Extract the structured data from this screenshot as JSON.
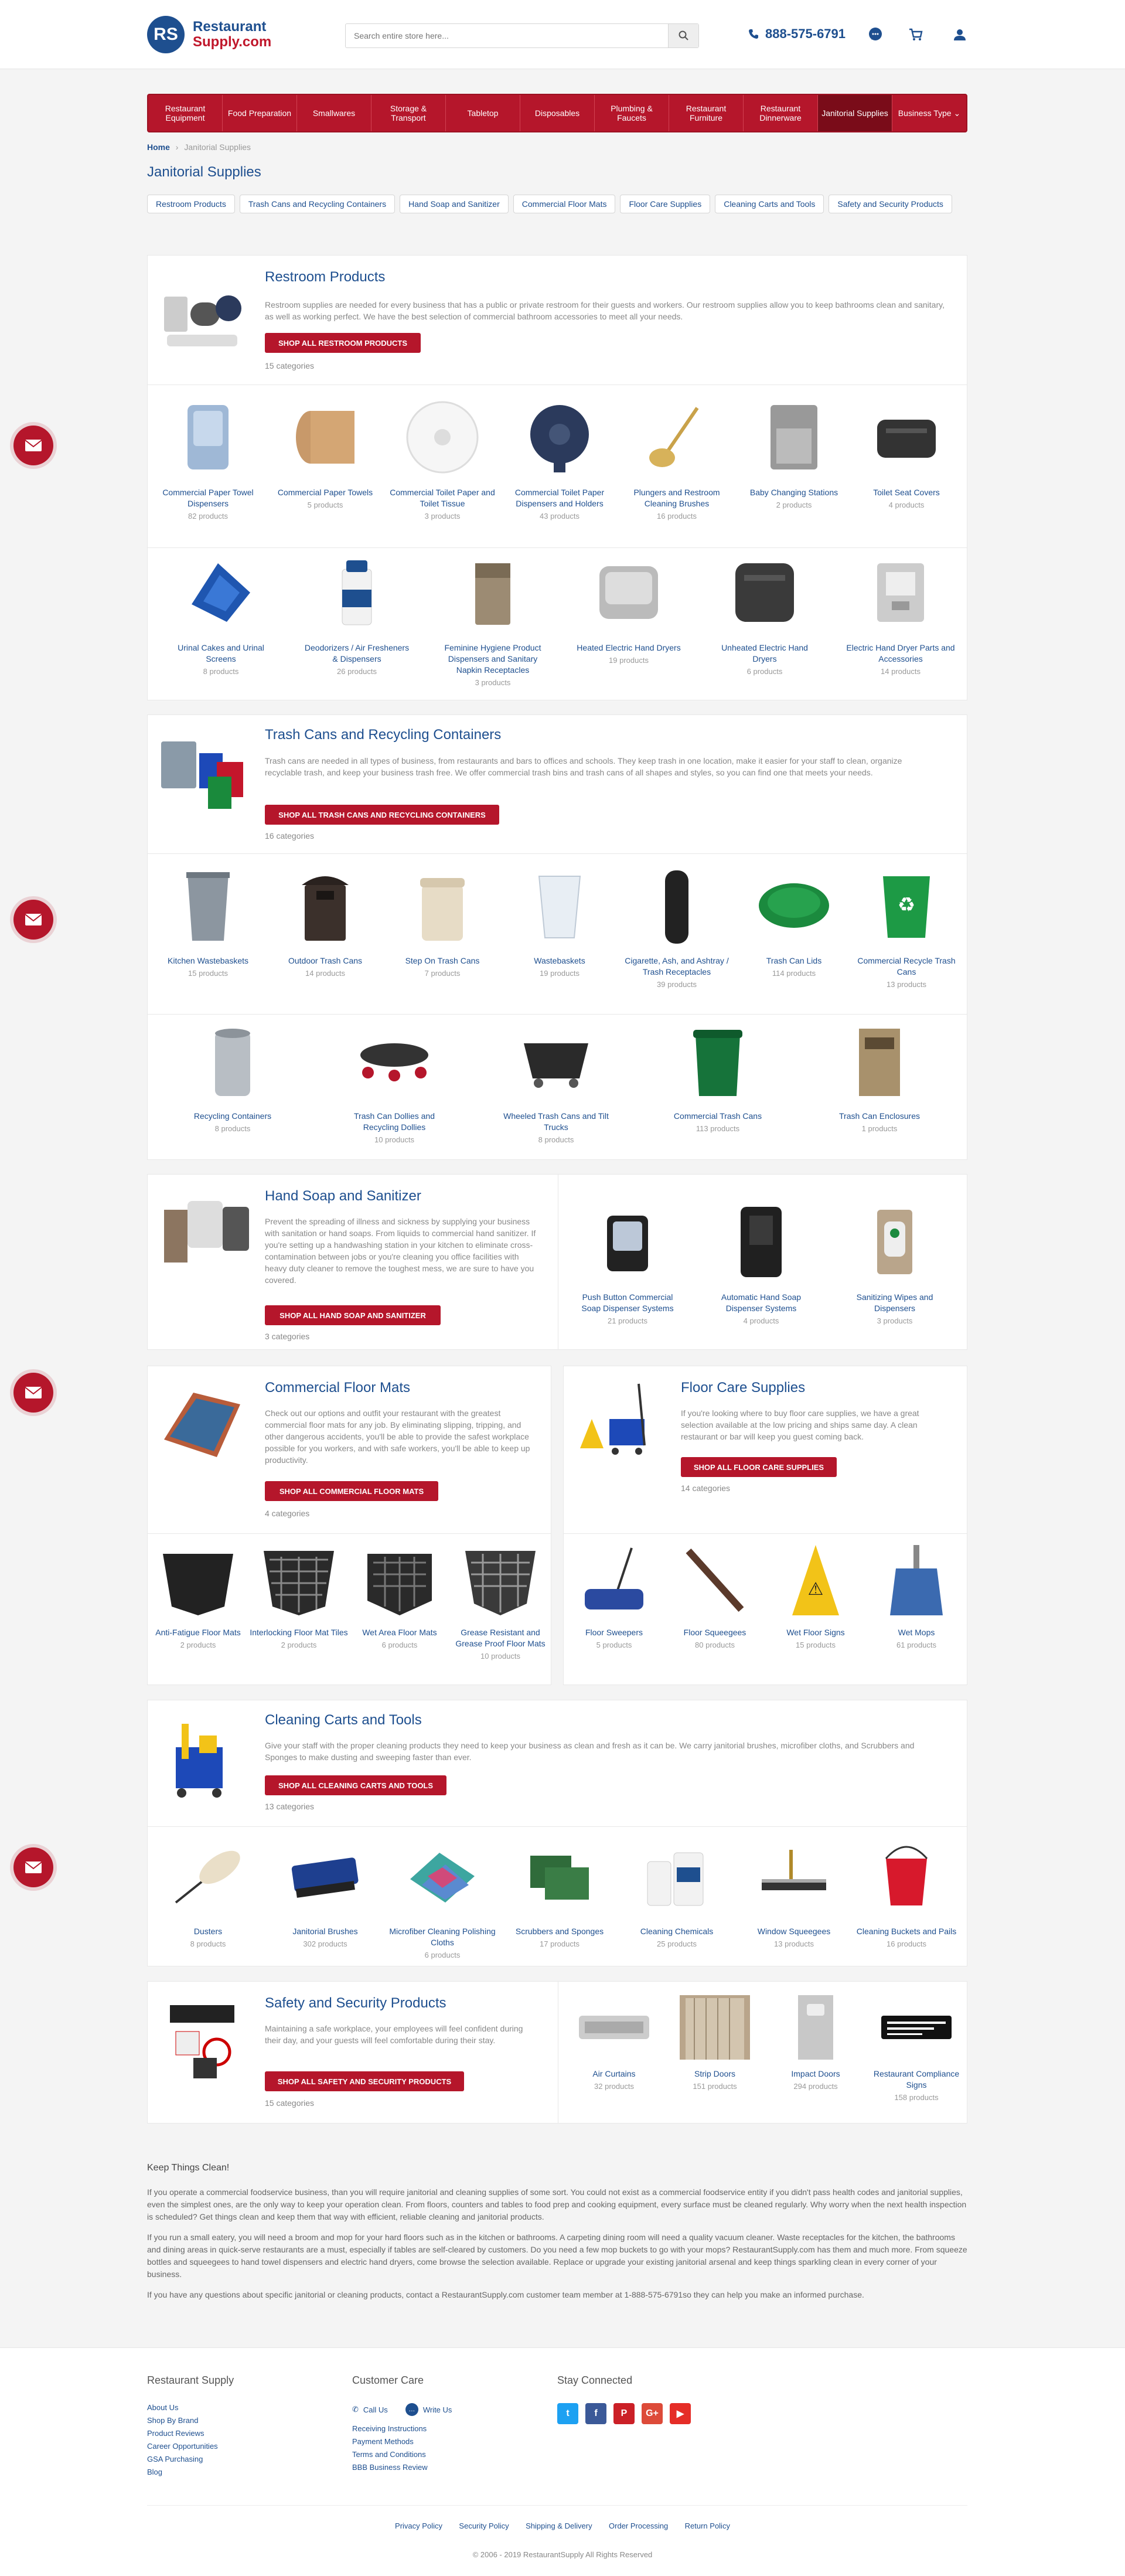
{
  "header": {
    "logo_mark": "RS",
    "logo_line1": "Restaurant",
    "logo_line2": "Supply.com",
    "search_placeholder": "Search entire store here...",
    "phone": "888-575-6791"
  },
  "nav": [
    "Restaurant Equipment",
    "Food Preparation",
    "Smallwares",
    "Storage & Transport",
    "Tabletop",
    "Disposables",
    "Plumbing & Faucets",
    "Restaurant Furniture",
    "Restaurant Dinnerware",
    "Janitorial Supplies",
    "Business Type"
  ],
  "breadcrumb": {
    "home": "Home",
    "sep": "›",
    "current": "Janitorial Supplies"
  },
  "page_title": "Janitorial Supplies",
  "chips": [
    "Restroom Products",
    "Trash Cans and Recycling Containers",
    "Hand Soap and Sanitizer",
    "Commercial Floor Mats",
    "Floor Care Supplies",
    "Cleaning Carts and Tools",
    "Safety and Security Products"
  ],
  "restroom": {
    "title": "Restroom Products",
    "desc": "Restroom supplies are needed for every business that has a public or private restroom for their guests and workers. Our restroom supplies allow you to keep bathrooms clean and sanitary, as well as working perfect. We have the best selection of commercial bathroom accessories to meet all your needs.",
    "button": "SHOP ALL RESTROOM PRODUCTS",
    "count": "15 categories",
    "items": [
      {
        "name": "Commercial Paper Towel Dispensers",
        "count": "82 products"
      },
      {
        "name": "Commercial Paper Towels",
        "count": "5 products"
      },
      {
        "name": "Commercial Toilet Paper and Toilet Tissue",
        "count": "3 products"
      },
      {
        "name": "Commercial Toilet Paper Dispensers and Holders",
        "count": "43 products"
      },
      {
        "name": "Plungers and Restroom Cleaning Brushes",
        "count": "16 products"
      },
      {
        "name": "Baby Changing Stations",
        "count": "2 products"
      },
      {
        "name": "Toilet Seat Covers",
        "count": "4 products"
      },
      {
        "name": "Urinal Cakes and Urinal Screens",
        "count": "8 products"
      },
      {
        "name": "Deodorizers / Air Fresheners & Dispensers",
        "count": "26 products"
      },
      {
        "name": "Feminine Hygiene Product Dispensers and Sanitary Napkin Receptacles",
        "count": "3 products"
      },
      {
        "name": "Heated Electric Hand Dryers",
        "count": "19 products"
      },
      {
        "name": "Unheated Electric Hand Dryers",
        "count": "6 products"
      },
      {
        "name": "Electric Hand Dryer Parts and Accessories",
        "count": "14 products"
      }
    ]
  },
  "trash": {
    "title": "Trash Cans and Recycling Containers",
    "desc": "Trash cans are needed in all types of business, from restaurants and bars to offices and schools. They keep trash in one location, make it easier for your staff to clean, organize recyclable trash, and keep your business trash free. We offer commercial trash bins and trash cans of all shapes and styles, so you can find one that meets your needs.",
    "button": "SHOP ALL TRASH CANS AND RECYCLING CONTAINERS",
    "count": "16 categories",
    "items": [
      {
        "name": "Kitchen Wastebaskets",
        "count": "15 products"
      },
      {
        "name": "Outdoor Trash Cans",
        "count": "14 products"
      },
      {
        "name": "Step On Trash Cans",
        "count": "7 products"
      },
      {
        "name": "Wastebaskets",
        "count": "19 products"
      },
      {
        "name": "Cigarette, Ash, and Ashtray / Trash Receptacles",
        "count": "39 products"
      },
      {
        "name": "Trash Can Lids",
        "count": "114 products"
      },
      {
        "name": "Commercial Recycle Trash Cans",
        "count": "13 products"
      },
      {
        "name": "Recycling Containers",
        "count": "8 products"
      },
      {
        "name": "Trash Can Dollies and Recycling Dollies",
        "count": "10 products"
      },
      {
        "name": "Wheeled Trash Cans and Tilt Trucks",
        "count": "8 products"
      },
      {
        "name": "Commercial Trash Cans",
        "count": "113 products"
      },
      {
        "name": "Trash Can Enclosures",
        "count": "1 products"
      }
    ]
  },
  "soap": {
    "title": "Hand Soap and Sanitizer",
    "desc": "Prevent the spreading of illness and sickness by supplying your business with sanitation or hand soaps. From liquids to commercial hand sanitizer. If you're setting up a handwashing station in your kitchen to eliminate cross-contamination between jobs or you're cleaning you office facilities with heavy duty cleaner to remove the toughest mess, we are sure to have you covered.",
    "button": "SHOP ALL HAND SOAP AND SANITIZER",
    "count": "3 categories",
    "items": [
      {
        "name": "Push Button Commercial Soap Dispenser Systems",
        "count": "21 products"
      },
      {
        "name": "Automatic Hand Soap Dispenser Systems",
        "count": "4 products"
      },
      {
        "name": "Sanitizing Wipes and Dispensers",
        "count": "3 products"
      }
    ]
  },
  "mats": {
    "title": "Commercial Floor Mats",
    "desc": "Check out our options and outfit your restaurant with the greatest commercial floor mats for any job. By eliminating slipping, tripping, and other dangerous accidents, you'll be able to provide the safest workplace possible for you workers, and with safe workers, you'll be able to keep up productivity.",
    "button": "SHOP ALL COMMERCIAL FLOOR MATS",
    "count": "4 categories",
    "items": [
      {
        "name": "Anti-Fatigue Floor Mats",
        "count": "2 products"
      },
      {
        "name": "Interlocking Floor Mat Tiles",
        "count": "2 products"
      },
      {
        "name": "Wet Area Floor Mats",
        "count": "6 products"
      },
      {
        "name": "Grease Resistant and Grease Proof Floor Mats",
        "count": "10 products"
      }
    ]
  },
  "floorcare": {
    "title": "Floor Care Supplies",
    "desc": "If you're looking where to buy floor care supplies, we have a great selection available at the low pricing and ships same day. A clean restaurant or bar will keep you guest coming back.",
    "button": "SHOP ALL FLOOR CARE SUPPLIES",
    "count": "14 categories",
    "items": [
      {
        "name": "Floor Sweepers",
        "count": "5 products"
      },
      {
        "name": "Floor Squeegees",
        "count": "80 products"
      },
      {
        "name": "Wet Floor Signs",
        "count": "15 products"
      },
      {
        "name": "Wet Mops",
        "count": "61 products"
      }
    ]
  },
  "carts": {
    "title": "Cleaning Carts and Tools",
    "desc": "Give your staff with the proper cleaning products they need to keep your business as clean and fresh as it can be. We carry janitorial brushes, microfiber cloths, and Scrubbers and Sponges to make dusting and sweeping faster than ever.",
    "button": "SHOP ALL CLEANING CARTS AND TOOLS",
    "count": "13 categories",
    "items": [
      {
        "name": "Dusters",
        "count": "8 products"
      },
      {
        "name": "Janitorial Brushes",
        "count": "302 products"
      },
      {
        "name": "Microfiber Cleaning Polishing Cloths",
        "count": "6 products"
      },
      {
        "name": "Scrubbers and Sponges",
        "count": "17 products"
      },
      {
        "name": "Cleaning Chemicals",
        "count": "25 products"
      },
      {
        "name": "Window Squeegees",
        "count": "13 products"
      },
      {
        "name": "Cleaning Buckets and Pails",
        "count": "16 products"
      }
    ]
  },
  "safety": {
    "title": "Safety and Security Products",
    "desc": "Maintaining a safe workplace, your employees will feel confident during their day, and your guests will feel comfortable during their stay.",
    "button": "SHOP ALL SAFETY AND SECURITY PRODUCTS",
    "count": "15 categories",
    "items": [
      {
        "name": "Air Curtains",
        "count": "32 products"
      },
      {
        "name": "Strip Doors",
        "count": "151 products"
      },
      {
        "name": "Impact Doors",
        "count": "294 products"
      },
      {
        "name": "Restaurant Compliance Signs",
        "count": "158 products"
      }
    ]
  },
  "info": {
    "title": "Keep Things Clean!",
    "p1": "If you operate a commercial foodservice business, than you will require janitorial and cleaning supplies of some sort. You could not exist as a commercial foodservice entity if you didn't pass health codes and janitorial supplies, even the simplest ones, are the only way to keep your operation clean. From floors, counters and tables to food prep and cooking equipment, every surface must be cleaned regularly. Why worry when the next health inspection is scheduled? Get things clean and keep them that way with efficient, reliable cleaning and janitorial products.",
    "p2": "If you run a small eatery, you will need a broom and mop for your hard floors such as in the kitchen or bathrooms. A carpeting dining room will need a quality vacuum cleaner. Waste receptacles for the kitchen, the bathrooms and dining areas in quick-serve restaurants are a must, especially if tables are self-cleared by customers. Do you need a few mop buckets to go with your mops? RestaurantSupply.com has them and much more. From squeeze bottles and squeegees to hand towel dispensers and electric hand dryers, come browse the selection available. Replace or upgrade your existing janitorial arsenal and keep things sparkling clean in every corner of your business.",
    "p3": "If you have any questions about specific janitorial or cleaning products, contact a RestaurantSupply.com customer team member at 1-888-575-6791so they can help you make an informed purchase."
  },
  "footer": {
    "col1_title": "Restaurant Supply",
    "col1_links": [
      "About Us",
      "Shop By Brand",
      "Product Reviews",
      "Career Opportunities",
      "GSA Purchasing",
      "Blog"
    ],
    "col2_title": "Customer Care",
    "call": "Call Us",
    "write": "Write Us",
    "col2_links": [
      "Receiving Instructions",
      "Payment Methods",
      "Terms and Conditions",
      "BBB Business Review"
    ],
    "col3_title": "Stay Connected",
    "social": [
      {
        "glyph": "t",
        "color": "#1da1f2"
      },
      {
        "glyph": "f",
        "color": "#3b5998"
      },
      {
        "glyph": "P",
        "color": "#cb2027"
      },
      {
        "glyph": "G+",
        "color": "#dd4b39"
      },
      {
        "glyph": "▶",
        "color": "#e52d27"
      }
    ],
    "bottom_links": [
      "Privacy Policy",
      "Security Policy",
      "Shipping & Delivery",
      "Order Processing",
      "Return Policy"
    ],
    "copyright": "© 2006 - 2019 RestaurantSupply All Rights Reserved"
  }
}
